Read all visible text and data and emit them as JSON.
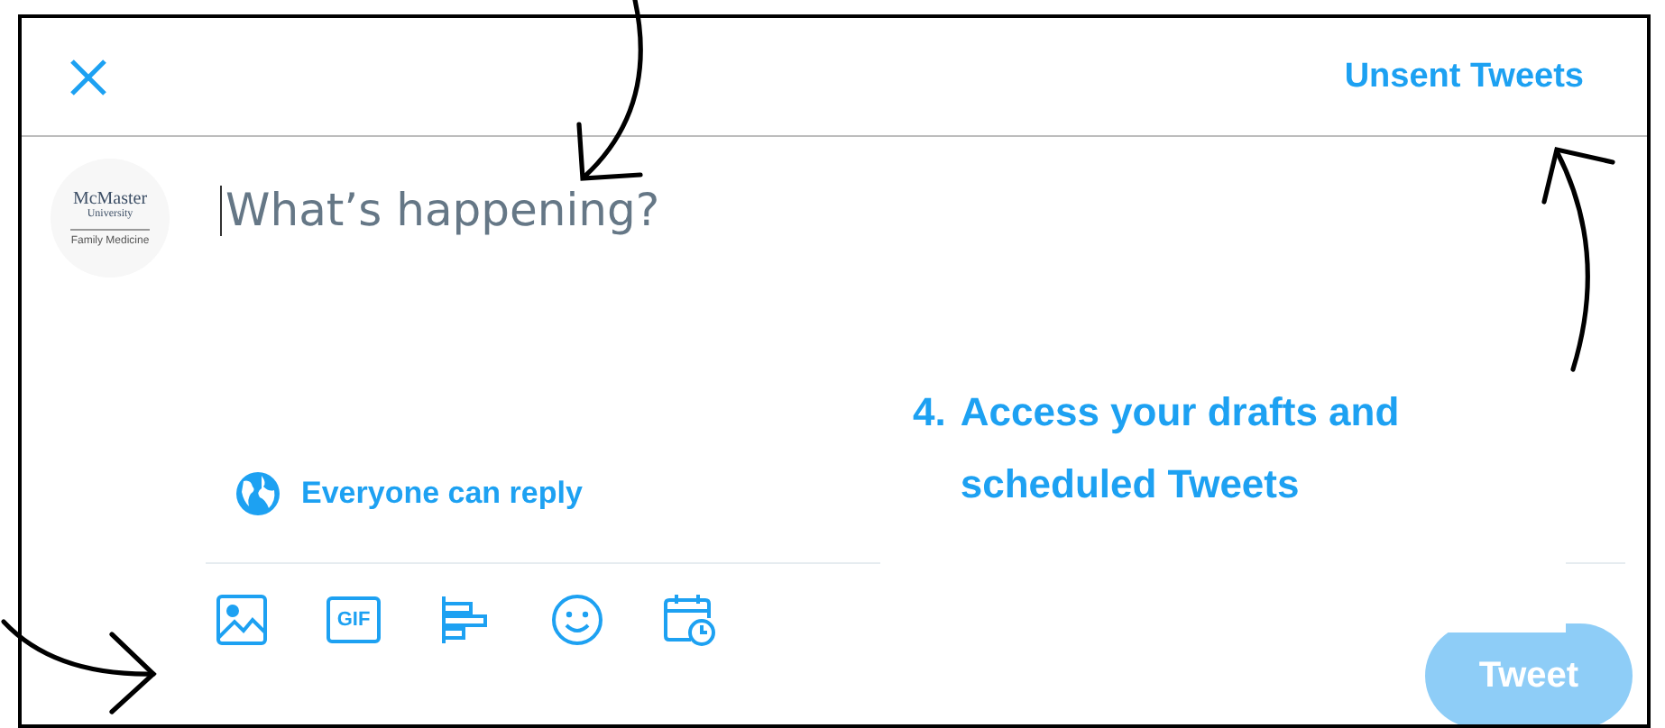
{
  "header": {
    "link": "Unsent Tweets"
  },
  "avatar": {
    "lines": [
      "McMaster",
      "University",
      "Family Medicine"
    ]
  },
  "composer": {
    "placeholder": "What’s happening?"
  },
  "reply_setting": {
    "label": "Everyone can reply"
  },
  "toolbar": [
    {
      "kind": "image"
    },
    {
      "kind": "gif",
      "label": "GIF"
    },
    {
      "kind": "poll"
    },
    {
      "kind": "emoji"
    },
    {
      "kind": "schedule"
    }
  ],
  "tweet_button": {
    "label": "Tweet",
    "disabled": true
  },
  "annotation": {
    "number": "4.",
    "text": "Access your drafts and scheduled Tweets"
  }
}
